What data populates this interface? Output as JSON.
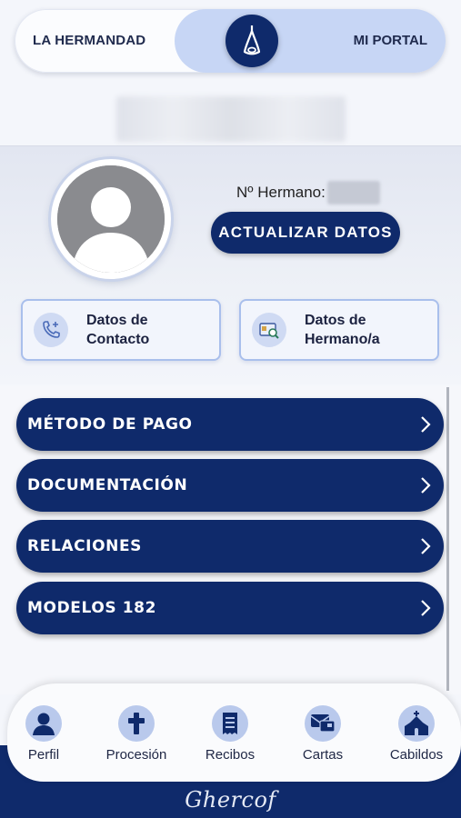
{
  "toggle": {
    "left_label": "LA HERMANDAD",
    "right_label": "MI PORTAL",
    "knob_icon": "nazareno-hood-icon"
  },
  "profile": {
    "member_number_label": "Nº Hermano:",
    "update_button_label": "ACTUALIZAR DATOS",
    "avatar_icon": "user-placeholder-icon"
  },
  "cards": [
    {
      "label_line1": "Datos de",
      "label_line2": "Contacto",
      "icon": "phone-plus-icon"
    },
    {
      "label_line1": "Datos de",
      "label_line2": "Hermano/a",
      "icon": "id-card-search-icon"
    }
  ],
  "menu": [
    {
      "label": "MÉTODO DE PAGO"
    },
    {
      "label": "DOCUMENTACIÓN"
    },
    {
      "label": "RELACIONES"
    },
    {
      "label": "MODELOS 182"
    }
  ],
  "bottom_nav": [
    {
      "label": "Perfil",
      "icon": "user-icon"
    },
    {
      "label": "Procesión",
      "icon": "cross-icon"
    },
    {
      "label": "Recibos",
      "icon": "receipt-icon"
    },
    {
      "label": "Cartas",
      "icon": "mail-icon"
    },
    {
      "label": "Cabildos",
      "icon": "church-icon"
    }
  ],
  "footer": {
    "logo_text": "Ghercof"
  },
  "colors": {
    "primary": "#0f2a6b",
    "accent_light": "#c7d6f5",
    "card_border": "#a9bfec"
  }
}
